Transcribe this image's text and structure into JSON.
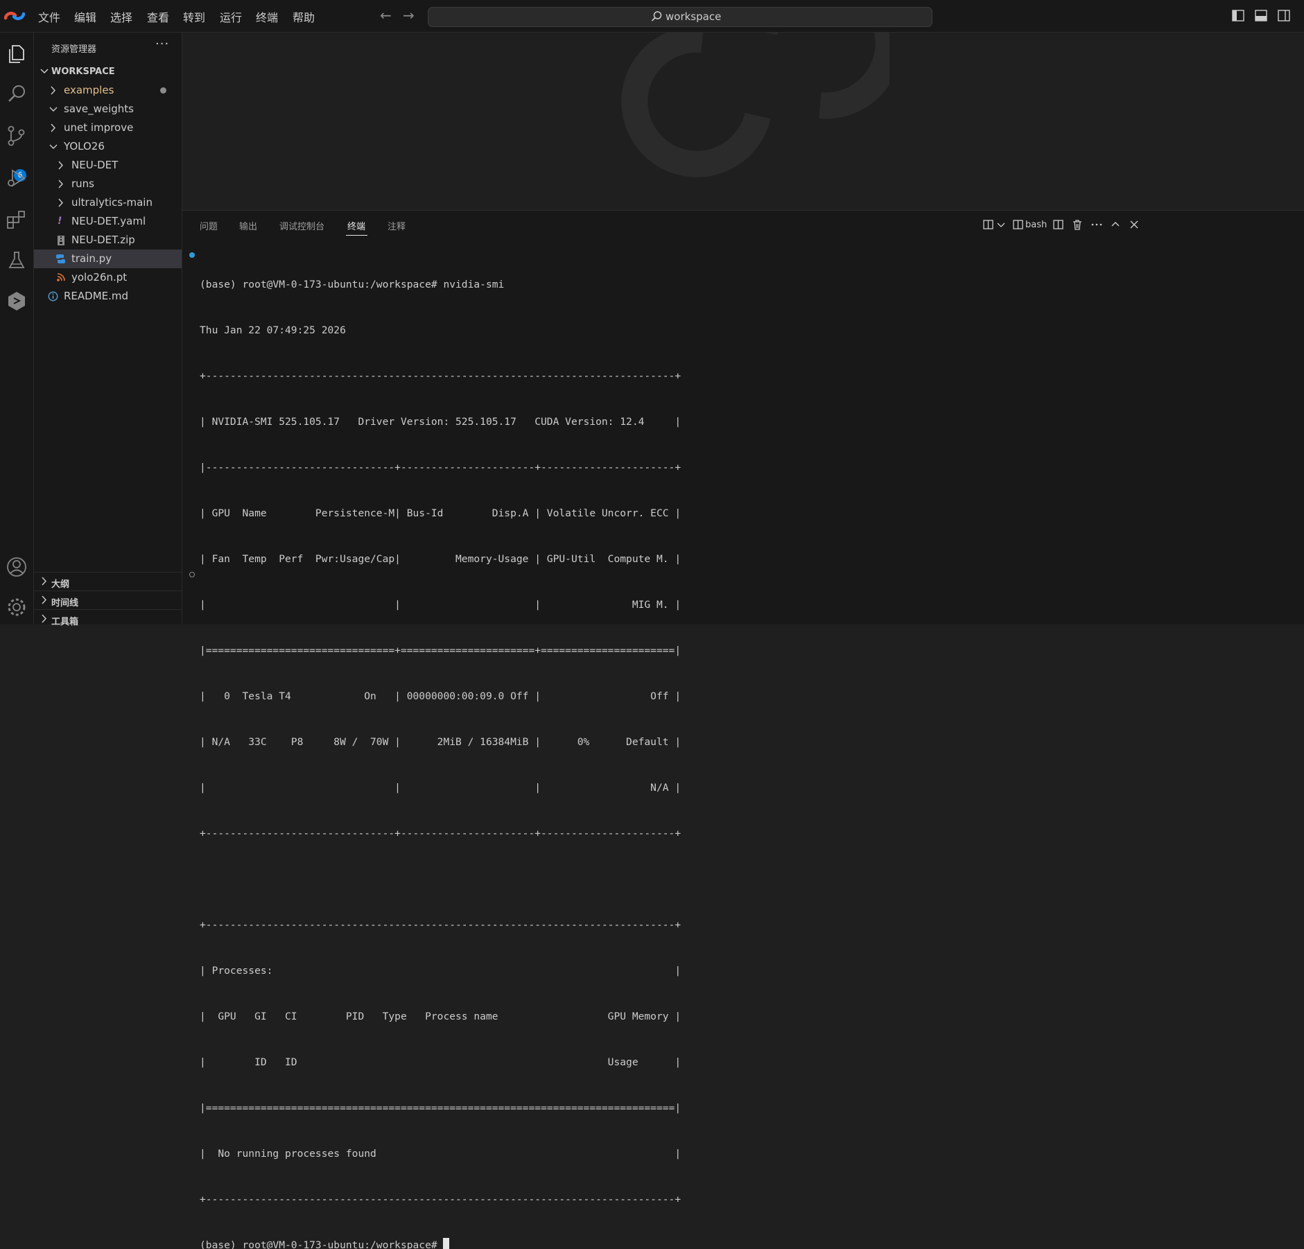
{
  "titlebar": {
    "menus": [
      "文件",
      "编辑",
      "选择",
      "查看",
      "转到",
      "运行",
      "终端",
      "帮助"
    ],
    "search_text": "workspace"
  },
  "activitybar": {
    "scm_badge": "6"
  },
  "sidebar": {
    "title": "资源管理器",
    "more": "···",
    "workspace_label": "WORKSPACE",
    "tree": [
      {
        "label": "examples",
        "type": "folder",
        "expanded": false,
        "modified": true,
        "color": "#e2c08d"
      },
      {
        "label": "save_weights",
        "type": "folder",
        "expanded": true
      },
      {
        "label": "unet improve",
        "type": "folder",
        "expanded": false
      },
      {
        "label": "YOLO26",
        "type": "folder",
        "expanded": true
      },
      {
        "label": "NEU-DET",
        "type": "folder",
        "expanded": false
      },
      {
        "label": "runs",
        "type": "folder",
        "expanded": false
      },
      {
        "label": "ultralytics-main",
        "type": "folder",
        "expanded": false
      },
      {
        "label": "NEU-DET.yaml",
        "type": "file",
        "icon": "yaml-exclamation-icon"
      },
      {
        "label": "NEU-DET.zip",
        "type": "file",
        "icon": "zip-file-icon"
      },
      {
        "label": "train.py",
        "type": "file",
        "icon": "python-icon",
        "selected": true
      },
      {
        "label": "yolo26n.pt",
        "type": "file",
        "icon": "rss-feed-icon"
      },
      {
        "label": "README.md",
        "type": "file",
        "icon": "info-icon"
      }
    ],
    "bottom_sections": [
      "大纲",
      "时间线",
      "工具箱"
    ]
  },
  "panel": {
    "tabs": [
      "问题",
      "输出",
      "调试控制台",
      "终端",
      "注释"
    ],
    "active_tab": "终端",
    "shell_label": "bash"
  },
  "terminal": {
    "lines": [
      "(base) root@VM-0-173-ubuntu:/workspace# nvidia-smi",
      "Thu Jan 22 07:49:25 2026",
      "+-----------------------------------------------------------------------------+",
      "| NVIDIA-SMI 525.105.17   Driver Version: 525.105.17   CUDA Version: 12.4     |",
      "|-------------------------------+----------------------+----------------------+",
      "| GPU  Name        Persistence-M| Bus-Id        Disp.A | Volatile Uncorr. ECC |",
      "| Fan  Temp  Perf  Pwr:Usage/Cap|         Memory-Usage | GPU-Util  Compute M. |",
      "|                               |                      |               MIG M. |",
      "|===============================+======================+======================|",
      "|   0  Tesla T4            On   | 00000000:00:09.0 Off |                  Off |",
      "| N/A   33C    P8     8W /  70W |      2MiB / 16384MiB |      0%      Default |",
      "|                               |                      |                  N/A |",
      "+-------------------------------+----------------------+----------------------+",
      "",
      "+-----------------------------------------------------------------------------+",
      "| Processes:                                                                  |",
      "|  GPU   GI   CI        PID   Type   Process name                  GPU Memory |",
      "|        ID   ID                                                   Usage      |",
      "|=============================================================================|",
      "|  No running processes found                                                 |",
      "+-----------------------------------------------------------------------------+",
      "(base) root@VM-0-173-ubuntu:/workspace# "
    ]
  },
  "colors": {
    "accent": "#0078d4",
    "modified_folder": "#e2c08d",
    "python": "#3b8fd9",
    "rss": "#e37933",
    "yaml": "#a074c4"
  }
}
